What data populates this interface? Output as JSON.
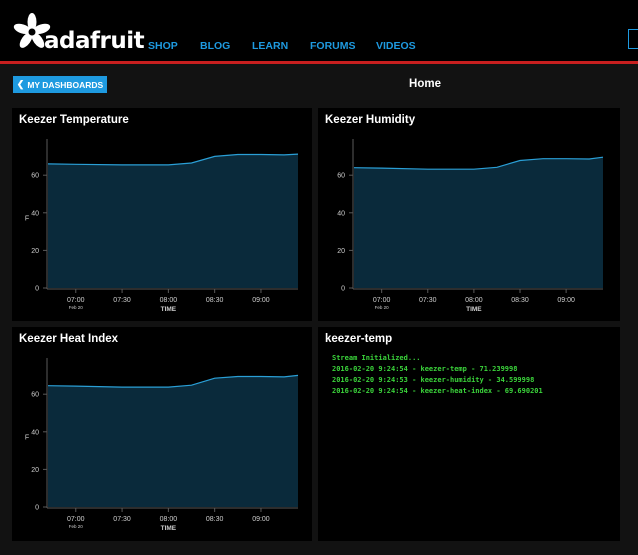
{
  "brand": {
    "name": "adafruit"
  },
  "nav": {
    "links": [
      "SHOP",
      "BLOG",
      "LEARN",
      "FORUMS",
      "VIDEOS"
    ]
  },
  "toolbar": {
    "back_label": "MY DASHBOARDS"
  },
  "page": {
    "title": "Home"
  },
  "colors": {
    "accent": "#1e9ae0",
    "nav_border": "#c81f1f",
    "chart_fill": "#0a2a3b",
    "chart_line": "#2a9fd6",
    "stream_text": "#3bd43b"
  },
  "charts": [
    {
      "title": "Keezer Temperature",
      "ylabel": "F",
      "xlabel": "TIME",
      "yticks": [
        "60",
        "40",
        "20",
        "0"
      ],
      "xticks": [
        "07:00",
        "07:30",
        "08:00",
        "08:30",
        "09:00"
      ],
      "xtick_sub": "Feb 20"
    },
    {
      "title": "Keezer Humidity",
      "ylabel": "",
      "xlabel": "TIME",
      "yticks": [
        "60",
        "40",
        "20",
        "0"
      ],
      "xticks": [
        "07:00",
        "07:30",
        "08:00",
        "08:30",
        "09:00"
      ],
      "xtick_sub": "Feb 20"
    },
    {
      "title": "Keezer Heat Index",
      "ylabel": "F",
      "xlabel": "TIME",
      "yticks": [
        "60",
        "40",
        "20",
        "0"
      ],
      "xticks": [
        "07:00",
        "07:30",
        "08:00",
        "08:30",
        "09:00"
      ],
      "xtick_sub": "Feb 20"
    }
  ],
  "chart_data": [
    {
      "type": "area",
      "title": "Keezer Temperature",
      "ylim": [
        0,
        75
      ],
      "x": [
        "06:42",
        "07:00",
        "07:30",
        "08:00",
        "08:15",
        "08:30",
        "08:45",
        "09:00",
        "09:15",
        "09:24"
      ],
      "values": [
        66,
        65.8,
        65.5,
        65.5,
        66.5,
        70,
        71,
        71,
        70.8,
        71.2
      ]
    },
    {
      "type": "area",
      "title": "Keezer Humidity",
      "ylim": [
        0,
        75
      ],
      "x": [
        "06:42",
        "07:00",
        "07:30",
        "08:00",
        "08:15",
        "08:30",
        "08:45",
        "09:00",
        "09:15",
        "09:24"
      ],
      "values": [
        64,
        63.8,
        63.2,
        63.2,
        64.2,
        67.8,
        68.8,
        68.8,
        68.6,
        69.6
      ]
    },
    {
      "type": "area",
      "title": "Keezer Heat Index",
      "ylim": [
        0,
        75
      ],
      "x": [
        "06:42",
        "07:00",
        "07:30",
        "08:00",
        "08:15",
        "08:30",
        "08:45",
        "09:00",
        "09:15",
        "09:24"
      ],
      "values": [
        64.5,
        64.3,
        63.8,
        63.8,
        64.8,
        68.5,
        69.4,
        69.4,
        69.2,
        70
      ]
    }
  ],
  "stream": {
    "title": "keezer-temp",
    "lines": [
      "Stream Initialized...",
      "2016-02-20 9:24:54 - keezer-temp - 71.239998",
      "2016-02-20 9:24:53 - keezer-humidity - 34.599998",
      "2016-02-20 9:24:54 - keezer-heat-index - 69.690201"
    ]
  }
}
